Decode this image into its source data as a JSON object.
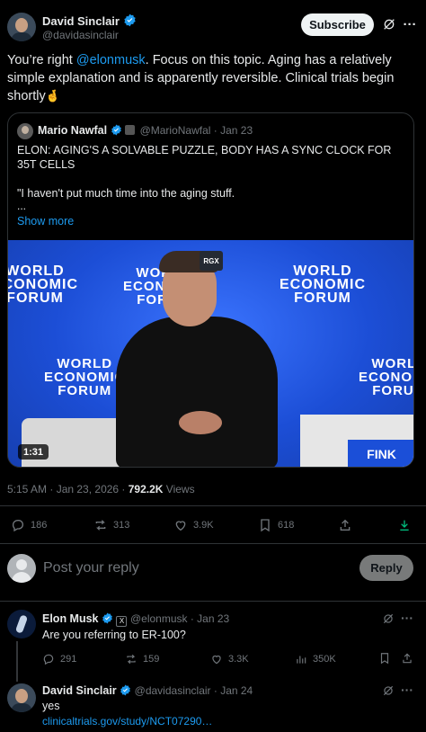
{
  "main_tweet": {
    "author_name": "David Sinclair",
    "author_handle": "@davidasinclair",
    "subscribe_label": "Subscribe",
    "text_before": "You’re right ",
    "mention": "@elonmusk",
    "text_after": ". Focus on this topic. Aging has a relatively simple explanation and is apparently reversible. Clinical trials begin shortly",
    "emoji": "🤞",
    "timestamp": "5:15 AM · Jan 23, 2026 · ",
    "views_count": "792.2K",
    "views_label": " Views",
    "actions": {
      "replies": "186",
      "reposts": "313",
      "likes": "3.9K",
      "bookmarks": "618"
    }
  },
  "quote": {
    "author_name": "Mario Nawfal",
    "author_handle": "@MarioNawfal · Jan 23",
    "headline": "ELON: AGING'S A SOLVABLE PUZZLE, BODY HAS A SYNC CLOCK FOR 35T CELLS",
    "body": "\"I haven't put much time into the aging stuff.",
    "ellipsis": "...",
    "show_more": "Show more",
    "video": {
      "duration": "1:31",
      "badge": "RGX",
      "wef_line1": "WORLD",
      "wef_line2": "ECONOMIC",
      "wef_line3": "FORUM",
      "nameplate": "FINK"
    }
  },
  "reply_box": {
    "placeholder": "Post your reply",
    "button": "Reply"
  },
  "replies": [
    {
      "author_name": "Elon Musk",
      "author_handle": "@elonmusk · Jan 23",
      "text": "Are you referring to ER-100?",
      "actions": {
        "replies": "291",
        "reposts": "159",
        "likes": "3.3K",
        "views": "350K"
      }
    },
    {
      "author_name": "David Sinclair",
      "author_handle": "@davidasinclair · Jan 24",
      "text": "yes",
      "link": "clinicaltrials.gov/study/NCT07290…"
    }
  ],
  "colors": {
    "accent": "#1d9bf0",
    "background": "#000000",
    "muted": "#71767b",
    "wef_blue": "#1b4fd8"
  }
}
